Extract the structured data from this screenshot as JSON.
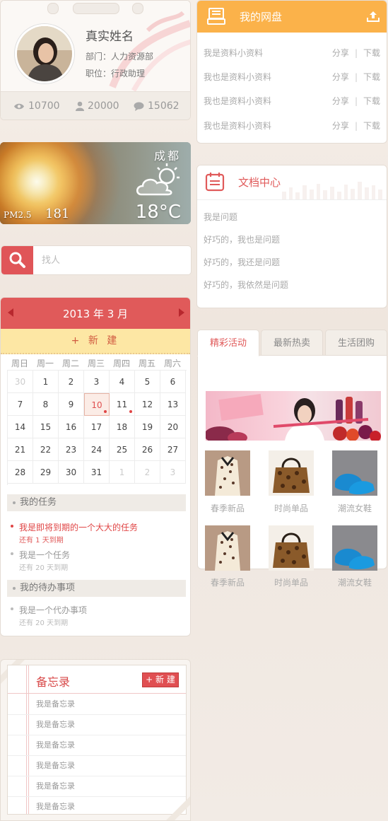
{
  "profile": {
    "name": "真实姓名",
    "department": "部门：人力资源部",
    "position": "职位：行政助理",
    "stats": {
      "views": "10700",
      "followers": "20000",
      "comments": "15062"
    }
  },
  "weather": {
    "city": "成都",
    "pm_label": "PM2.5",
    "pm_value": "181",
    "temperature": "18°C"
  },
  "search": {
    "placeholder": "找人"
  },
  "calendar": {
    "title": "2013 年 3 月",
    "new_label": "+ 新 建",
    "weekdays": [
      "周日",
      "周一",
      "周二",
      "周三",
      "周四",
      "周五",
      "周六"
    ],
    "weeks": [
      [
        "30",
        "1",
        "2",
        "3",
        "4",
        "5",
        "6"
      ],
      [
        "7",
        "8",
        "9",
        "10",
        "11",
        "12",
        "13"
      ],
      [
        "14",
        "15",
        "16",
        "17",
        "18",
        "19",
        "20"
      ],
      [
        "21",
        "22",
        "23",
        "24",
        "25",
        "26",
        "27"
      ],
      [
        "28",
        "29",
        "30",
        "31",
        "1",
        "2",
        "3"
      ]
    ]
  },
  "tasks": {
    "heading": "我的任务",
    "items": [
      {
        "title": "我是即将到期的一个大大的任务",
        "due": "还有 1 天到期"
      },
      {
        "title": "我是一个任务",
        "due": "还有 20 天到期"
      }
    ]
  },
  "todos": {
    "heading": "我的待办事项",
    "items": [
      {
        "title": "我是一个代办事项",
        "due": "还有 20 天到期"
      }
    ]
  },
  "memo": {
    "title": "备忘录",
    "new_label": "+ 新 建",
    "items": [
      "我是备忘录",
      "我是备忘录",
      "我是备忘录",
      "我是备忘录",
      "我是备忘录",
      "我是备忘录"
    ]
  },
  "netdisk": {
    "title": "我的网盘",
    "share": "分享",
    "download": "下载",
    "files": [
      "我是资料小资料",
      "我也是资料小资料",
      "我也是资料小资料",
      "我也是资料小资料"
    ]
  },
  "docs": {
    "title": "文档中心",
    "items": [
      "我是问题",
      "好巧的，我也是问题",
      "好巧的，我还是问题",
      "好巧的，我依然是问题"
    ]
  },
  "activity": {
    "tabs": [
      "精彩活动",
      "最新热卖",
      "生活团购"
    ],
    "products": [
      "春季新品",
      "时尚单品",
      "潮流女鞋",
      "春季新品",
      "时尚单品",
      "潮流女鞋"
    ]
  },
  "colors": {
    "accent_red": "#e05a5a",
    "accent_orange": "#fbb24a",
    "new_bar": "#fde7a4"
  }
}
